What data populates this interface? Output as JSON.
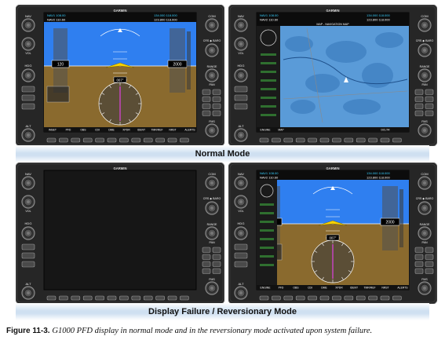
{
  "displays": {
    "top_left": {
      "role": "PFD",
      "state": "normal"
    },
    "top_right": {
      "role": "MFD",
      "state": "normal"
    },
    "bottom_left": {
      "role": "PFD",
      "state": "failed"
    },
    "bottom_right": {
      "role": "PFD",
      "state": "reversionary"
    }
  },
  "bezel": {
    "brand": "GARMIN",
    "left_labels": [
      "NAV",
      "VOL",
      "HDG",
      "ALT"
    ],
    "right_labels": [
      "COM",
      "CRS",
      "BARO",
      "RANGE",
      "PAN",
      "FMS"
    ],
    "right_keys": [
      "AP",
      "FD",
      "HDG",
      "NAV",
      "APR",
      "VS",
      "FLC",
      "ALT",
      "VNV",
      "BC",
      "DN",
      "UP"
    ]
  },
  "pfd": {
    "nav_freq_active": "108.00",
    "nav_freq_standby": "110.60",
    "com_freq_active": "134.000",
    "com_freq_standby": "118.000",
    "com2_active": "123.800",
    "com2_standby": "118.000",
    "heading": "007°",
    "airspeed": "120",
    "altitude": "2000",
    "softkeys": [
      "INSET",
      "PFD",
      "OBS",
      "CDI",
      "DME",
      "XPDR",
      "IDENT",
      "TMR/REF",
      "NRST",
      "ALERTS"
    ]
  },
  "mfd": {
    "title": "MAP - NAVIGATION MAP",
    "softkeys": [
      "ENGINE",
      "MAP",
      "DCLTR"
    ]
  },
  "labels": {
    "normal_mode": "Normal Mode",
    "failure_mode": "Display Failure / Reversionary Mode"
  },
  "caption": {
    "prefix": "Figure 11-3.",
    "text": "G1000 PFD display in normal mode and in the reversionary mode activated upon system failure."
  },
  "colors": {
    "sky": "#2f7ff0",
    "ground": "#8a6a2e",
    "bezel": "#2b2b2b",
    "map_land": "#4e8ecf",
    "failed_screen": "#161616",
    "divider": "#cfe0f1"
  }
}
